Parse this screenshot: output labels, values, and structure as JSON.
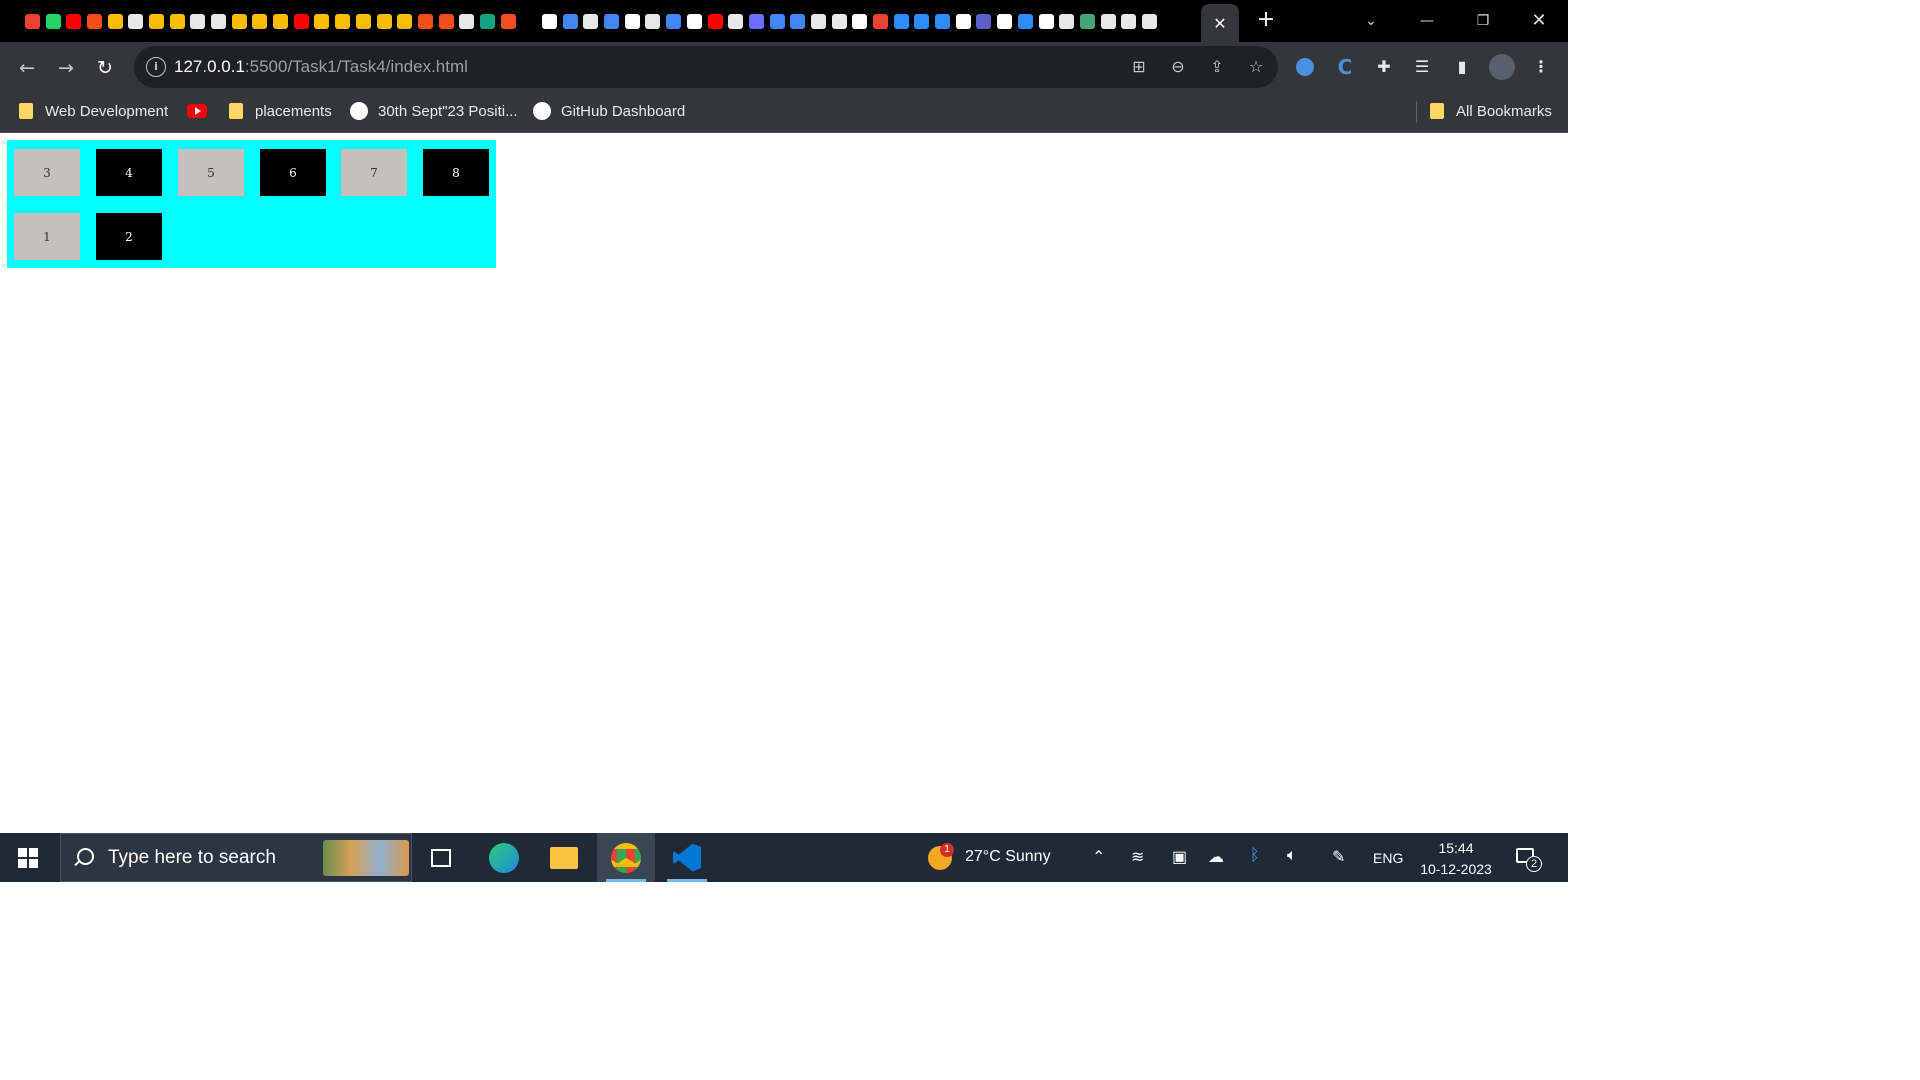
{
  "browser": {
    "tabs_bar": {
      "close_active_tab_glyph": "✕",
      "new_tab_glyph": "+",
      "tab_favicon_colors": [
        "#ea4335",
        "#25d366",
        "#ff0000",
        "#f24e1e",
        "#fbbc04",
        "#e8e8e8",
        "#fbbc04",
        "#fbbc04",
        "#e8e8e8",
        "#e8e8e8",
        "#fbbc04",
        "#fbbc04",
        "#fbbc04",
        "#ff0000",
        "#fbbc04",
        "#fbbc04",
        "#fbbc04",
        "#fbbc04",
        "#fbbc04",
        "#f24e1e",
        "#f24e1e",
        "#e8e8e8",
        "#10a37f",
        "#f25022",
        "#000000",
        "#ffffff",
        "#4285f4",
        "#e8e8e8",
        "#4285f4",
        "#ffffff",
        "#e8e8e8",
        "#4285f4",
        "#ffffff",
        "#ff0000",
        "#e8e8e8",
        "#6c6cff",
        "#4285f4",
        "#4285f4",
        "#e8e8e8",
        "#e8e8e8",
        "#ffffff",
        "#ea4335",
        "#2d8cff",
        "#2d8cff",
        "#2d8cff",
        "#ffffff",
        "#5b5fc7",
        "#ffffff",
        "#2d8cff",
        "#ffffff",
        "#e8e8e8",
        "#44a57a",
        "#e8e8e8",
        "#e8e8e8",
        "#e8e8e8"
      ]
    },
    "address_bar": {
      "url_host": "127.0.0.1",
      "url_rest": ":5500/Task1/Task4/index.html"
    },
    "bookmarks": [
      {
        "label": "Web Development",
        "icon": "folder-icon"
      },
      {
        "label": "",
        "icon": "youtube-icon"
      },
      {
        "label": "placements",
        "icon": "folder-icon"
      },
      {
        "label": "30th Sept\"23 Positi...",
        "icon": "wordpress-icon"
      },
      {
        "label": "GitHub Dashboard",
        "icon": "github-icon"
      }
    ],
    "all_bookmarks": "All Bookmarks"
  },
  "page": {
    "container_color": "#00ffff",
    "boxes": [
      {
        "label": "3",
        "style": "light"
      },
      {
        "label": "4",
        "style": "dark"
      },
      {
        "label": "5",
        "style": "light"
      },
      {
        "label": "6",
        "style": "dark"
      },
      {
        "label": "7",
        "style": "light"
      },
      {
        "label": "8",
        "style": "dark"
      },
      {
        "label": "1",
        "style": "light"
      },
      {
        "label": "2",
        "style": "dark"
      }
    ]
  },
  "taskbar": {
    "search_placeholder": "Type here to search",
    "weather": "27°C  Sunny",
    "weather_badge": "1",
    "language": "ENG",
    "time": "15:44",
    "date": "10-12-2023",
    "notification_count": "2"
  }
}
